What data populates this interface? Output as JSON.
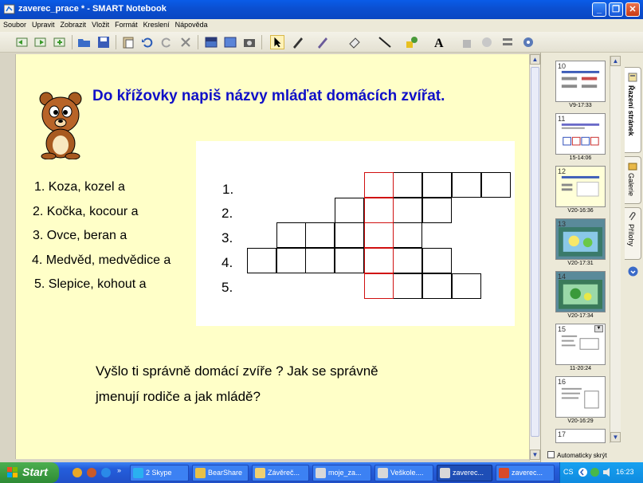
{
  "window": {
    "title": "zaverec_prace * - SMART Notebook"
  },
  "menu": [
    "Soubor",
    "Upravit",
    "Zobrazit",
    "Vložit",
    "Formát",
    "Kreslení",
    "Nápověda"
  ],
  "page": {
    "heading": "Do křížovky napiš názvy mláďat domácích zvířat.",
    "clues": [
      "1. Koza, kozel a",
      "2. Kočka, kocour a",
      "3. Ovce, beran a",
      "4. Medvěd, medvědice a",
      "5. Slepice, kohout a"
    ],
    "row_numbers": [
      "1.",
      "2.",
      "3.",
      "4.",
      "5."
    ],
    "question_line1": "Vyšlo ti správně domácí zvíře ? Jak se správně",
    "question_line2": "jmenují rodiče a jak mládě?"
  },
  "sorter": {
    "thumbnails": [
      {
        "num": "10",
        "label": "V9-17:33"
      },
      {
        "num": "11",
        "label": "15-14:06"
      },
      {
        "num": "12",
        "label": "V20-16:36"
      },
      {
        "num": "13",
        "label": "V20-17:31"
      },
      {
        "num": "14",
        "label": "V20-17:34"
      },
      {
        "num": "15",
        "label": "11-20:24"
      },
      {
        "num": "16",
        "label": "V20-16:29"
      },
      {
        "num": "17",
        "label": ""
      }
    ],
    "autohide_label": "Automaticky skrýt"
  },
  "side_tabs": [
    "Řazení stránek",
    "Galerie",
    "Přílohy"
  ],
  "taskbar": {
    "start": "Start",
    "tasks": [
      "2 Skype",
      "BearShare",
      "Závěreč...",
      "moje_za...",
      "Veškole....",
      "zaverec...",
      "zaverec..."
    ],
    "lang": "CS",
    "clock": "16:23"
  },
  "colors": {
    "page_bg": "#FFFFC8",
    "heading": "#1010C8",
    "solution_border": "#D01010",
    "titlebar": "#0A5CE8"
  }
}
